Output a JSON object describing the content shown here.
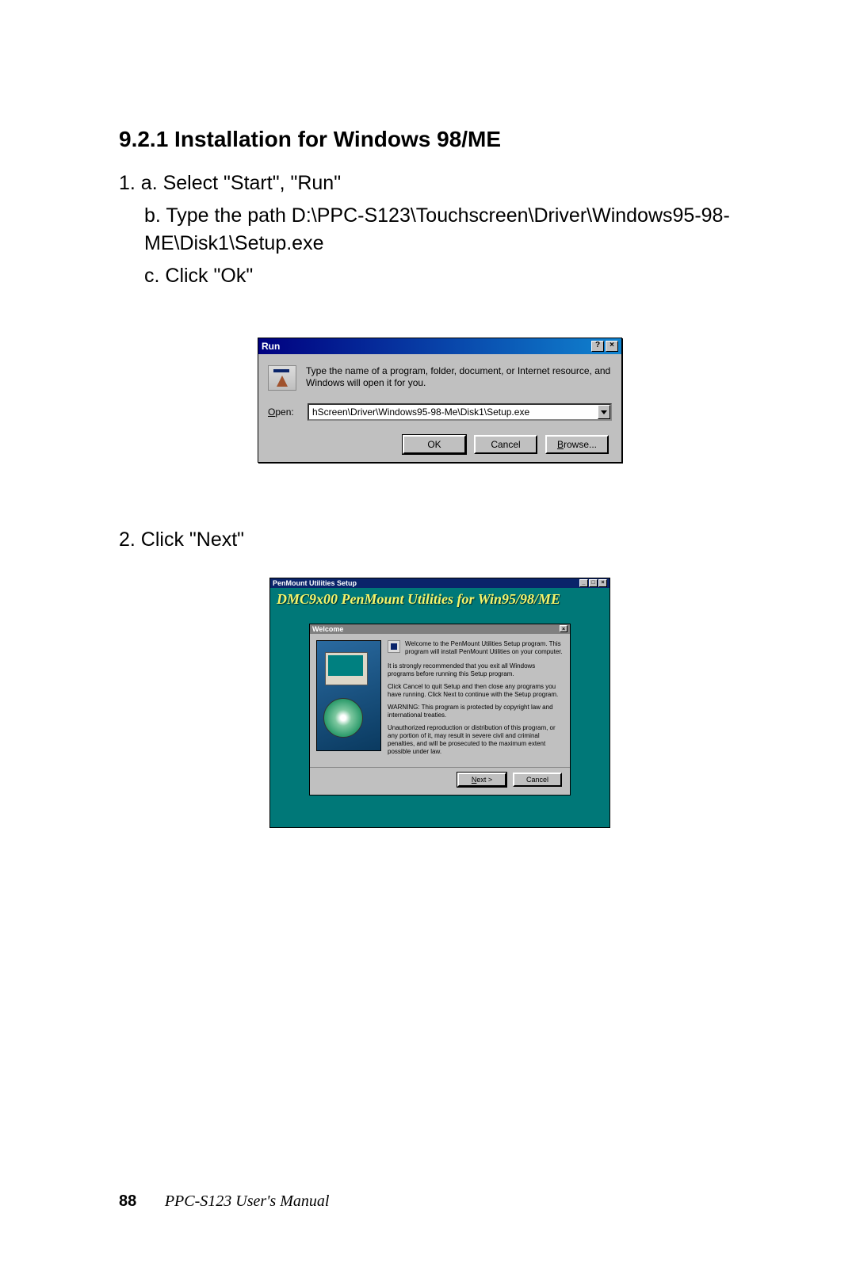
{
  "heading": "9.2.1 Installation for Windows 98/ME",
  "step1a": "1. a. Select \"Start\", \"Run\"",
  "step1b": "b. Type the path D:\\PPC-S123\\Touchscreen\\Driver\\Windows95-98-ME\\Disk1\\Setup.exe",
  "step1c": "c. Click \"Ok\"",
  "step2": "2. Click \"Next\"",
  "run": {
    "title": "Run",
    "help_glyph": "?",
    "close_glyph": "×",
    "desc": "Type the name of a program, folder, document, or Internet resource, and Windows will open it for you.",
    "open_label": "Open:",
    "open_underline": "O",
    "input_value": "hScreen\\Driver\\Windows95-98-Me\\Disk1\\Setup.exe",
    "ok": "OK",
    "cancel": "Cancel",
    "browse": "Browse..."
  },
  "setup": {
    "window_title": "PenMount Utilities Setup",
    "banner": "DMC9x00 PenMount Utilities for Win95/98/ME",
    "min_glyph": "_",
    "max_glyph": "□",
    "close_glyph": "×",
    "welcome": {
      "title": "Welcome",
      "close_glyph": "×",
      "p1": "Welcome to the PenMount Utilities Setup program. This program will install PenMount Utilities on your computer.",
      "p2": "It is strongly recommended that you exit all Windows programs before running this Setup program.",
      "p3": "Click Cancel to quit Setup and then close any programs you have running. Click Next to continue with the Setup program.",
      "p4": "WARNING: This program is protected by copyright law and international treaties.",
      "p5": "Unauthorized reproduction or distribution of this program, or any portion of it, may result in severe civil and criminal penalties, and will be prosecuted to the maximum extent possible under law.",
      "next": "Next >",
      "cancel": "Cancel"
    }
  },
  "footer": {
    "page_number": "88",
    "doc_title": "PPC-S123  User's Manual"
  }
}
